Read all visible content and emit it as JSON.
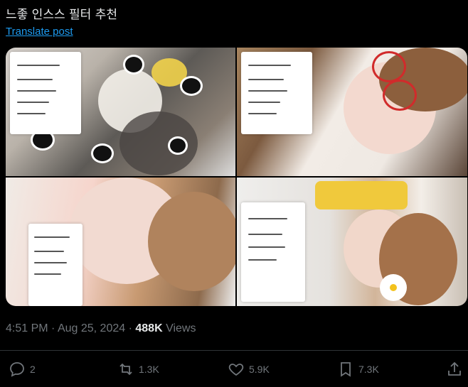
{
  "post": {
    "text": "느좋 인스스 필터 추천",
    "translate_label": "Translate post",
    "time": "4:51 PM",
    "separator": "·",
    "date": "Aug 25, 2024",
    "views_count": "488K",
    "views_label": "Views"
  },
  "actions": {
    "replies": "2",
    "reposts": "1.3K",
    "likes": "5.9K",
    "bookmarks": "7.3K"
  },
  "colors": {
    "link": "#1d9bf0",
    "muted": "#71767b",
    "text": "#e7e9ea",
    "background": "#000000"
  }
}
